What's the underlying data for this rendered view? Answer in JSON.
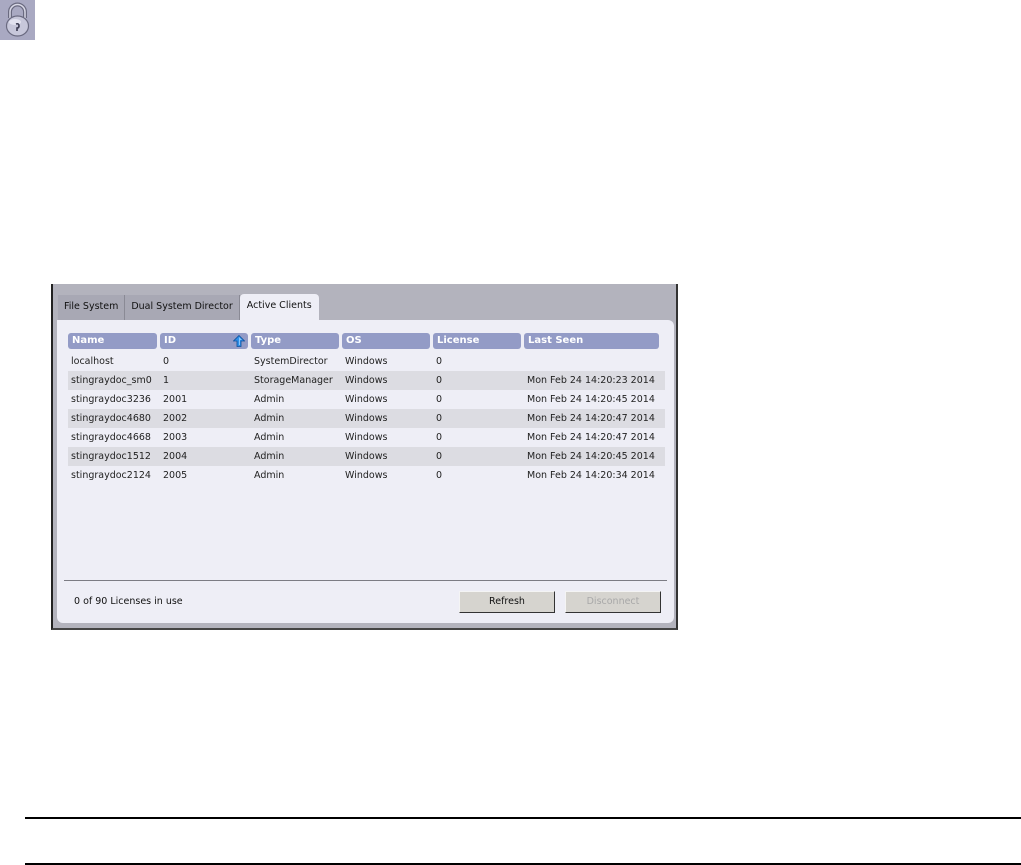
{
  "icons": {
    "lock": "lock-icon",
    "sort": "sort-ascending-icon"
  },
  "tabs": [
    {
      "label": "File System",
      "active": false
    },
    {
      "label": "Dual System Director",
      "active": false
    },
    {
      "label": "Active Clients",
      "active": true
    }
  ],
  "table": {
    "columns": [
      "Name",
      "ID",
      "Type",
      "OS",
      "License",
      "Last Seen"
    ],
    "sorted_column": "ID",
    "sort_direction": "ascending",
    "rows": [
      {
        "name": "localhost",
        "id": "0",
        "type": "SystemDirector",
        "os": "Windows",
        "license": "0",
        "last_seen": ""
      },
      {
        "name": "stingraydoc_sm0",
        "id": "1",
        "type": "StorageManager",
        "os": "Windows",
        "license": "0",
        "last_seen": "Mon Feb 24 14:20:23 2014"
      },
      {
        "name": "stingraydoc3236",
        "id": "2001",
        "type": "Admin",
        "os": "Windows",
        "license": "0",
        "last_seen": "Mon Feb 24 14:20:45 2014"
      },
      {
        "name": "stingraydoc4680",
        "id": "2002",
        "type": "Admin",
        "os": "Windows",
        "license": "0",
        "last_seen": "Mon Feb 24 14:20:47 2014"
      },
      {
        "name": "stingraydoc4668",
        "id": "2003",
        "type": "Admin",
        "os": "Windows",
        "license": "0",
        "last_seen": "Mon Feb 24 14:20:47 2014"
      },
      {
        "name": "stingraydoc1512",
        "id": "2004",
        "type": "Admin",
        "os": "Windows",
        "license": "0",
        "last_seen": "Mon Feb 24 14:20:45 2014"
      },
      {
        "name": "stingraydoc2124",
        "id": "2005",
        "type": "Admin",
        "os": "Windows",
        "license": "0",
        "last_seen": "Mon Feb 24 14:20:34 2014"
      }
    ]
  },
  "footer": {
    "license_status": "0 of 90 Licenses in use",
    "refresh_label": "Refresh",
    "disconnect_label": "Disconnect",
    "disconnect_enabled": false
  },
  "colors": {
    "header_bg": "#939bc6",
    "panel_bg": "#eeeef6",
    "alt_row_bg": "#dcdce2",
    "window_bg": "#b3b3bd"
  }
}
